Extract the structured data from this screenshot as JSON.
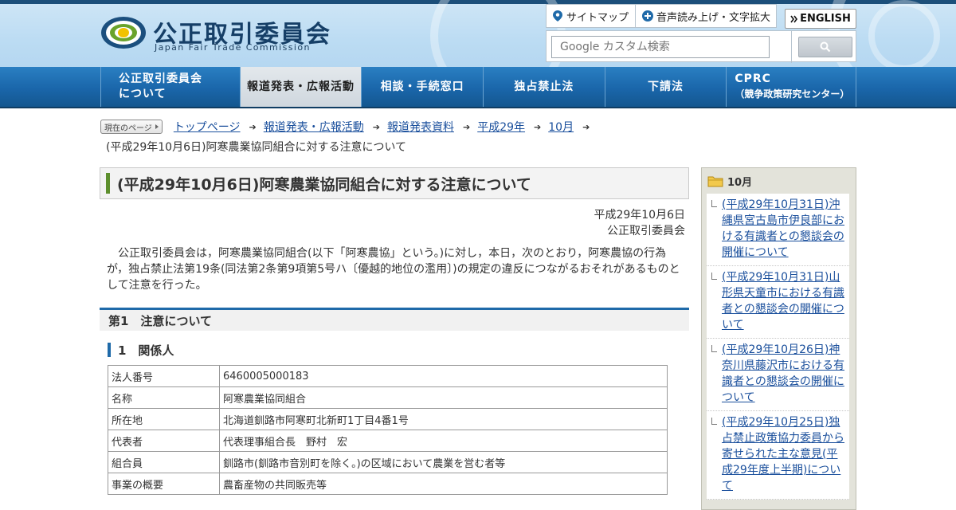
{
  "header": {
    "logo_jp": "公正取引委員会",
    "logo_en": "Japan Fair Trade Commission",
    "util": {
      "sitemap": "サイトマップ",
      "voice": "音声読み上げ・文字拡大"
    },
    "english": "ENGLISH",
    "search": {
      "placeholder": "Google カスタム検索"
    }
  },
  "nav": [
    {
      "line1": "公正取引委員会",
      "line2": "について"
    },
    {
      "label": "報道発表・広報活動"
    },
    {
      "label": "相談・手続窓口"
    },
    {
      "label": "独占禁止法"
    },
    {
      "label": "下請法"
    },
    {
      "line1": "CPRC",
      "line2": "（競争政策研究センター）"
    }
  ],
  "breadcrumb": {
    "badge": "現在のページ",
    "links": [
      "トップページ",
      "報道発表・広報活動",
      "報道発表資料",
      "平成29年",
      "10月"
    ],
    "current": "(平成29年10月6日)阿寒農業協同組合に対する注意について"
  },
  "article": {
    "title": "(平成29年10月6日)阿寒農業協同組合に対する注意について",
    "date": "平成29年10月6日",
    "org": "公正取引委員会",
    "lead": "公正取引委員会は，阿寒農業協同組合(以下「阿寒農協」という。)に対し，本日，次のとおり，阿寒農協の行為が，独占禁止法第19条(同法第2条第9項第5号ハ〔優越的地位の濫用〕)の規定の違反につながるおそれがあるものとして注意を行った。",
    "section1": "第1　注意について",
    "sub1": "1　関係人",
    "table": [
      {
        "label": "法人番号",
        "value": "6460005000183"
      },
      {
        "label": "名称",
        "value": "阿寒農業協同組合"
      },
      {
        "label": "所在地",
        "value": "北海道釧路市阿寒町北新町1丁目4番1号"
      },
      {
        "label": "代表者",
        "value": "代表理事組合長　野村　宏"
      },
      {
        "label": "組合員",
        "value": "釧路市(釧路市音別町を除く。)の区域において農業を営む者等"
      },
      {
        "label": "事業の概要",
        "value": "農畜産物の共同販売等"
      }
    ]
  },
  "sidebar": {
    "heading": "10月",
    "items": [
      "(平成29年10月31日)沖縄県宮古島市伊良部における有識者との懇談会の開催について",
      "(平成29年10月31日)山形県天童市における有識者との懇談会の開催について",
      "(平成29年10月26日)神奈川県藤沢市における有識者との懇談会の開催について",
      "(平成29年10月25日)独占禁止政策協力委員から寄せられた主な意見(平成29年度上半期)について"
    ]
  },
  "colors": {
    "nav_blue": "#1a66aa",
    "title_bar": "#5d8f2d",
    "link": "#1a4f9c",
    "heading_rule": "#1f6aa9"
  }
}
